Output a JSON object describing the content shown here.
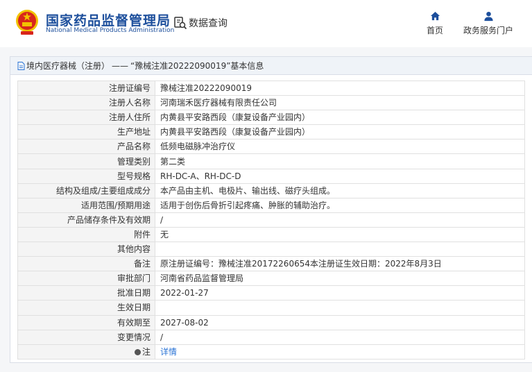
{
  "header": {
    "site_name_cn": "国家药品监督管理局",
    "site_name_en": "National Medical Products Administration",
    "query_label": "数据查询",
    "nav": [
      {
        "label": "首页",
        "icon": "home-icon"
      },
      {
        "label": "政务服务门户",
        "icon": "user-icon"
      }
    ]
  },
  "panel": {
    "breadcrumb_link": "境内医疗器械（注册）",
    "breadcrumb_sep": "——",
    "breadcrumb_current": "“豫械注准20222090019”基本信息"
  },
  "rows": [
    {
      "label": "注册证编号",
      "value": "豫械注准20222090019"
    },
    {
      "label": "注册人名称",
      "value": "河南瑞禾医疗器械有限责任公司"
    },
    {
      "label": "注册人住所",
      "value": "内黄县平安路西段（康复设备产业园内）"
    },
    {
      "label": "生产地址",
      "value": "内黄县平安路西段（康复设备产业园内）"
    },
    {
      "label": "产品名称",
      "value": "低频电磁脉冲治疗仪"
    },
    {
      "label": "管理类别",
      "value": "第二类"
    },
    {
      "label": "型号规格",
      "value": "RH-DC-A、RH-DC-D"
    },
    {
      "label": "结构及组成/主要组成成分",
      "value": "本产品由主机、电极片、输出线、磁疗头组成。"
    },
    {
      "label": "适用范围/预期用途",
      "value": "适用于创伤后骨折引起疼痛、肿胀的辅助治疗。"
    },
    {
      "label": "产品储存条件及有效期",
      "value": "/"
    },
    {
      "label": "附件",
      "value": "无"
    },
    {
      "label": "其他内容",
      "value": ""
    },
    {
      "label": "备注",
      "value": "原注册证编号：豫械注准20172260654本注册证生效日期：2022年8月3日"
    },
    {
      "label": "审批部门",
      "value": "河南省药品监督管理局"
    },
    {
      "label": "批准日期",
      "value": "2022-01-27"
    },
    {
      "label": "生效日期",
      "value": ""
    },
    {
      "label": "有效期至",
      "value": "2027-08-02"
    },
    {
      "label": "变更情况",
      "value": "/"
    }
  ],
  "note_row": {
    "label": "注",
    "link": "详情"
  },
  "colors": {
    "brand": "#1d4f9c",
    "link": "#2b74d6",
    "emblem_red": "#d8261b",
    "emblem_gold": "#f2c200"
  }
}
